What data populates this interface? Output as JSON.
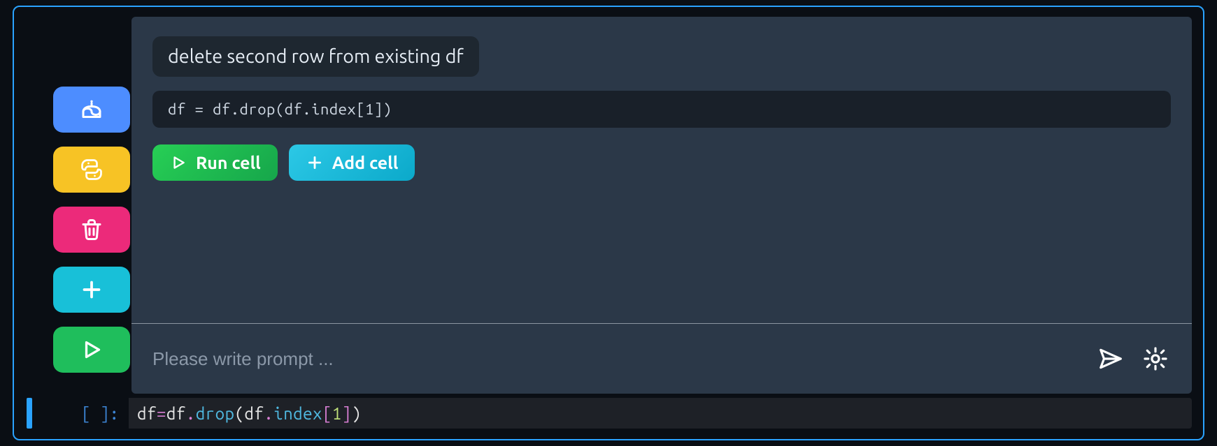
{
  "sidebar": {
    "items": [
      {
        "name": "cake-icon"
      },
      {
        "name": "python-icon"
      },
      {
        "name": "trash-icon"
      },
      {
        "name": "plus-icon"
      },
      {
        "name": "play-icon"
      }
    ]
  },
  "panel": {
    "query": "delete second row from existing df",
    "code": "df = df.drop(df.index[1])",
    "actions": {
      "run_label": "Run cell",
      "add_label": "Add cell"
    },
    "prompt_placeholder": "Please write prompt ..."
  },
  "cell": {
    "prompt_label": "[ ]:",
    "tokens": [
      {
        "t": "df ",
        "c": "id"
      },
      {
        "t": "=",
        "c": "op"
      },
      {
        "t": " df",
        "c": "id"
      },
      {
        "t": ".",
        "c": "op"
      },
      {
        "t": "drop",
        "c": "fn"
      },
      {
        "t": "(",
        "c": "par"
      },
      {
        "t": "df",
        "c": "id"
      },
      {
        "t": ".",
        "c": "op"
      },
      {
        "t": "index",
        "c": "fn"
      },
      {
        "t": "[",
        "c": "br"
      },
      {
        "t": "1",
        "c": "num"
      },
      {
        "t": "]",
        "c": "br"
      },
      {
        "t": ")",
        "c": "par"
      }
    ]
  }
}
